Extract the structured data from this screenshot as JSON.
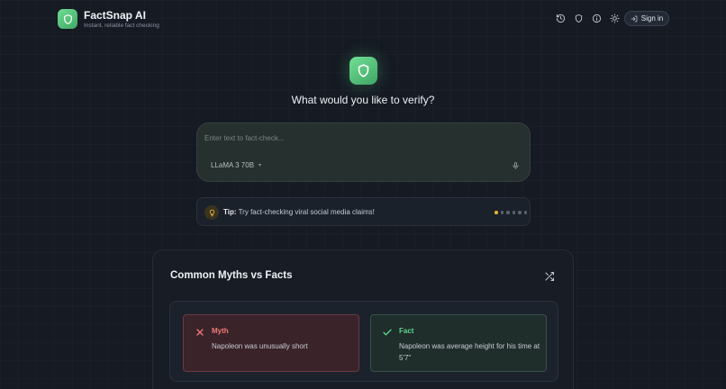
{
  "app": {
    "name": "FactSnap AI",
    "tagline": "Instant, reliable fact checking"
  },
  "header": {
    "icons": [
      "history-icon",
      "shield-icon",
      "info-icon",
      "sun-icon"
    ],
    "signin_label": "Sign in"
  },
  "hero": {
    "title": "What would you like to verify?"
  },
  "input": {
    "placeholder": "Enter text to fact-check...",
    "value": "",
    "model": "LLaMA 3 70B"
  },
  "tip": {
    "prefix": "Tip:",
    "text": "Try fact-checking viral social media claims!",
    "dot_count": 6,
    "active_dot": 0
  },
  "myths_section": {
    "title": "Common Myths vs Facts",
    "myth": {
      "label": "Myth",
      "text": "Napoleon was unusually short"
    },
    "fact": {
      "label": "Fact",
      "text": "Napoleon was average height for his time at 5'7\""
    }
  },
  "colors": {
    "accent_green": "#4fc27a",
    "myth_red": "#f07a78",
    "tip_yellow": "#e0b33a",
    "background": "#151a23"
  }
}
